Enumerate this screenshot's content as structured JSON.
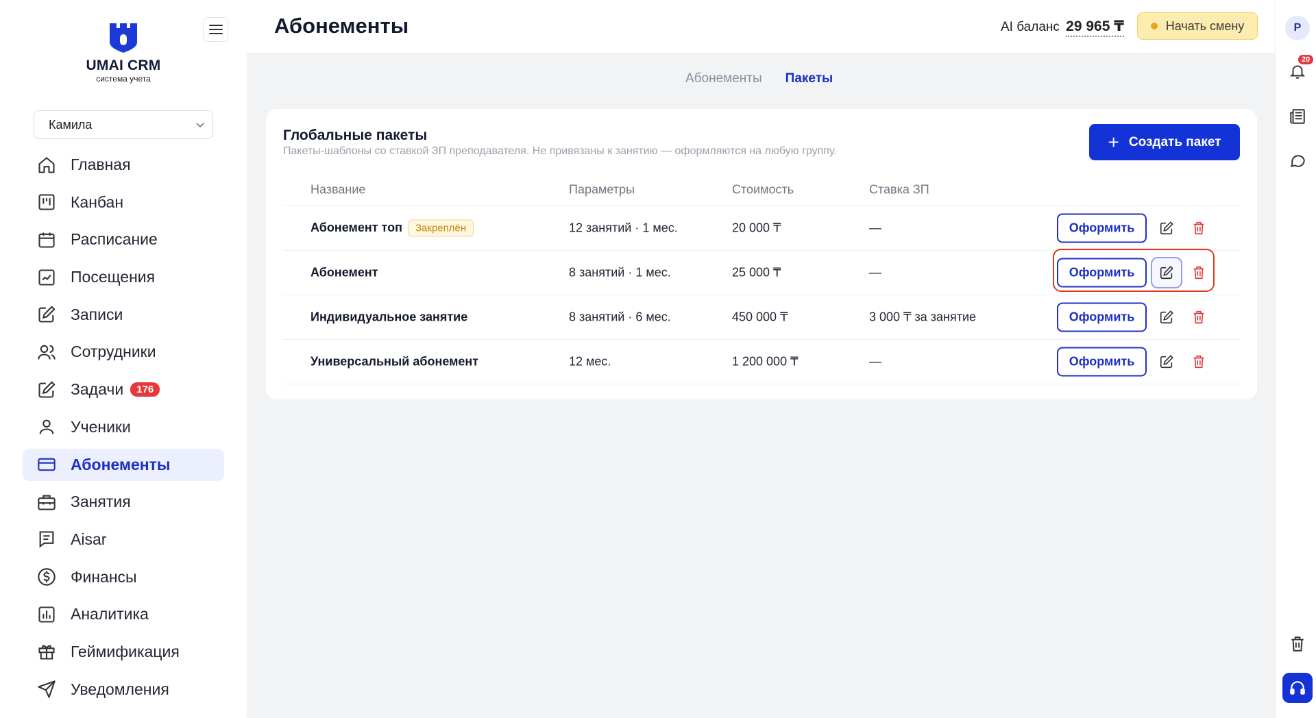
{
  "app": {
    "logo_title": "UMAI CRM",
    "logo_subtitle": "система учета"
  },
  "user_select": {
    "value": "Камила"
  },
  "nav": {
    "items": [
      {
        "label": "Главная",
        "icon": "home-icon"
      },
      {
        "label": "Канбан",
        "icon": "kanban-icon"
      },
      {
        "label": "Расписание",
        "icon": "calendar-icon"
      },
      {
        "label": "Посещения",
        "icon": "attendance-icon"
      },
      {
        "label": "Записи",
        "icon": "edit-note-icon"
      },
      {
        "label": "Сотрудники",
        "icon": "users-icon"
      },
      {
        "label": "Задачи",
        "icon": "tasks-icon",
        "badge": "176"
      },
      {
        "label": "Ученики",
        "icon": "user-icon"
      },
      {
        "label": "Абонементы",
        "icon": "card-icon",
        "active": true
      },
      {
        "label": "Занятия",
        "icon": "briefcase-icon"
      },
      {
        "label": "Aisar",
        "icon": "chat-doc-icon"
      },
      {
        "label": "Финансы",
        "icon": "dollar-icon"
      },
      {
        "label": "Аналитика",
        "icon": "chart-icon"
      },
      {
        "label": "Геймификация",
        "icon": "gift-icon"
      },
      {
        "label": "Уведомления",
        "icon": "send-icon"
      }
    ]
  },
  "header": {
    "title": "Абонементы",
    "ai_label": "AI баланс",
    "ai_amount": "29 965 ₸",
    "shift_button": "Начать смену"
  },
  "rail": {
    "avatar": "Р",
    "notifications_count": "20"
  },
  "tabs": [
    {
      "label": "Абонементы",
      "active": false
    },
    {
      "label": "Пакеты",
      "active": true
    }
  ],
  "card": {
    "title": "Глобальные пакеты",
    "subtitle": "Пакеты-шаблоны со ставкой ЗП преподавателя. Не привязаны к занятию — оформляются на любую группу.",
    "create_button": "Создать пакет",
    "columns": [
      "Название",
      "Параметры",
      "Стоимость",
      "Ставка ЗП"
    ],
    "action_label": "Оформить",
    "pinned_label": "Закреплён",
    "rows": [
      {
        "name": "Абонемент топ",
        "pinned": true,
        "params": "12 занятий · 1 мес.",
        "price": "20 000 ₸",
        "rate": "—"
      },
      {
        "name": "Абонемент",
        "pinned": false,
        "params": "8 занятий · 1 мес.",
        "price": "25 000 ₸",
        "rate": "—"
      },
      {
        "name": "Индивидуальное занятие",
        "pinned": false,
        "params": "8 занятий · 6 мес.",
        "price": "450 000 ₸",
        "rate": "3 000 ₸ за занятие"
      },
      {
        "name": "Универсальный абонемент",
        "pinned": false,
        "params": "12 мес.",
        "price": "1 200 000 ₸",
        "rate": "—"
      }
    ]
  },
  "colors": {
    "primary": "#1433d6",
    "accent_text": "#1e2fc4",
    "danger": "#e5393b",
    "highlight": "#e0391e",
    "shift_bg": "#fdecb0"
  }
}
